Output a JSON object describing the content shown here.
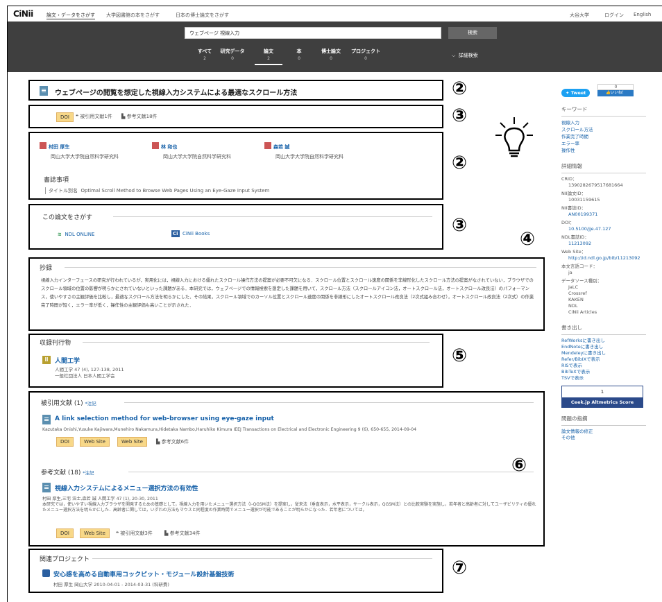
{
  "topbar": {
    "logo": "CiNii",
    "tabs": [
      "論文・データをさがす",
      "大学図書館の本をさがす",
      "日本の博士論文をさがす"
    ],
    "university": "大谷大学",
    "login": "ログイン",
    "lang": "English"
  },
  "search": {
    "query": "ウェブページ 視線入力",
    "button": "検索",
    "tabs": [
      {
        "label": "すべて",
        "count": "2"
      },
      {
        "label": "研究データ",
        "count": "0"
      },
      {
        "label": "論文",
        "count": "2"
      },
      {
        "label": "本",
        "count": "0"
      },
      {
        "label": "博士論文",
        "count": "0"
      },
      {
        "label": "プロジェクト",
        "count": "0"
      }
    ],
    "advanced": "詳細検索"
  },
  "article": {
    "title": "ウェブページの閲覧を想定した視線入力システムによる最適なスクロール方法",
    "doi_tag": "DOI",
    "cited_by": "被引用文献1件",
    "refs": "参考文献18件",
    "authors": [
      {
        "name": "村田 厚生",
        "affil": "岡山大学大学院自然科学研究科"
      },
      {
        "name": "林 和也",
        "affil": "岡山大学大学院自然科学研究科"
      },
      {
        "name": "森若 誠",
        "affil": "岡山大学大学院自然科学研究科"
      }
    ],
    "biblio_heading": "書誌事項",
    "alt_title_label": "タイトル別名",
    "alt_title": "Optimal Scroll Method to Browse Web Pages Using an Eye-Gaze Input System"
  },
  "find": {
    "heading": "この論文をさがす",
    "ndl": "NDL ONLINE",
    "cinii": "CiNii Books"
  },
  "abstract": {
    "heading": "抄録",
    "text": "視線入力インターフェースの研究が行われているが，実用化には，視線入力における優れたスクロール操作方法の提案が必要不可欠になる．スクロール位置とスクロール速度の関係を非線形化したスクロール方法の提案がなされていない，ブラウザでのスクロール領域の位置の影響が明らかにされていないといった課題がある．本研究では，ウェブページでの情報検索を想定した課題を用いて，スクロール方法（スクロールアイコン法，オートスクロール法，オートスクロール改良法）のパフォーマンス，使いやすさの主観評価を比較し，最適なスクロール方法を明らかにした．その結果，スクロール領域でのカーソル位置とスクロール速度の関係を非線形にしたオートスクロール改良法（2次式組み合わせ），オートスクロール改良法（2次式）の作業完了時間が短く，エラー率が低く，操作性の主観評価も高いことが示された．"
  },
  "journal": {
    "heading": "収録刊行物",
    "name": "人間工学",
    "vol": "人間工学 47 (4), 127-138, 2011",
    "publisher": "一般社団法人 日本人間工学会"
  },
  "citations": {
    "heading": "被引用文献 (1)",
    "note": "*注記",
    "item_title": "A link selection method for web-browser using eye-gaze input",
    "item_meta": "Kazutaka Onishi,Yusuke Kajiwara,Munehiro Nakamura,Hidetaka Nambo,Haruhiko Kimura IEEJ Transactions on Electrical and Electronic Engineering 9 (6), 650-655, 2014-09-04",
    "tags": [
      "DOI",
      "Web Site",
      "Web Site"
    ],
    "refs": "参考文献6件"
  },
  "references": {
    "heading": "参考文献 (18)",
    "note": "*注記",
    "item_title": "視線入力システムによるメニュー選択方法の有効性",
    "item_meta": "村田 厚生,三宅 浩士,森若 誠 人間工学 47 (1), 20-30, 2011",
    "item_text": "本研究では，使いやすい視線入力ブラウザを開発するための基礎として，視線入力を用いたメニュー選択方法（I-QGSM法）を提案し，従来法（垂直表示，水平表示，サークル表示，QGSM法）との比較実験を実施し，若年者と高齢者に対してユーザビリティの優れたメニュー選択方法を明らかにした．高齢者に関しては，いずれの方法もマウスと同程度の作業時間でメニュー選択が可能であることが明らかになった．若年者については，",
    "tags": [
      "DOI",
      "Web Site"
    ],
    "cited_by": "被引用文献3件",
    "refs": "参考文献34件"
  },
  "project": {
    "heading": "関連プロジェクト",
    "title": "安心感を高める自動車用コックピット・モジュール設計基盤技術",
    "meta": "村田 厚生 岡山大学 2010-04-01 - 2014-03-31 (科研費)"
  },
  "markers": [
    "②",
    "③",
    "②",
    "③",
    "④",
    "⑤",
    "⑥",
    "⑦"
  ],
  "sidebar": {
    "tweet": "Tweet",
    "like_count": "0",
    "like": "いいね！",
    "keywords_heading": "キーワード",
    "keywords": [
      "視線入力",
      "スクロール方法",
      "作業完了時間",
      "エラー率",
      "操作性"
    ],
    "details_heading": "詳細情報",
    "crid_label": "CRID：",
    "crid": "1390282679517681664",
    "naid_label": "NII論文ID：",
    "naid": "10031159615",
    "ncid_label": "NII書誌ID：",
    "ncid": "AN00199371",
    "doi_label": "DOI：",
    "doi": "10.5100/jje.47.127",
    "ndl_label": "NDL書誌ID：",
    "ndl": "11213092",
    "web_label": "Web Site：",
    "web": "http://id.ndl.go.jp/bib/11213092",
    "lang_label": "本文言語コード：",
    "lang": "ja",
    "source_label": "データソース種別：",
    "sources": [
      "JaLC",
      "Crossref",
      "KAKEN",
      "NDL",
      "CiNii Articles"
    ],
    "export_heading": "書き出し",
    "exports": [
      "RefWorksに書き出し",
      "EndNoteに書き出し",
      "Mendeleyに書き出し",
      "Refer/BibIXで表示",
      "RISで表示",
      "BibTeXで表示",
      "TSVで表示"
    ],
    "altmetric_count": "1",
    "altmetric_label": "Ceek.jp Altmetrics Score",
    "report_heading": "問題の指摘",
    "reports": [
      "論文情報の修正",
      "その他"
    ]
  }
}
